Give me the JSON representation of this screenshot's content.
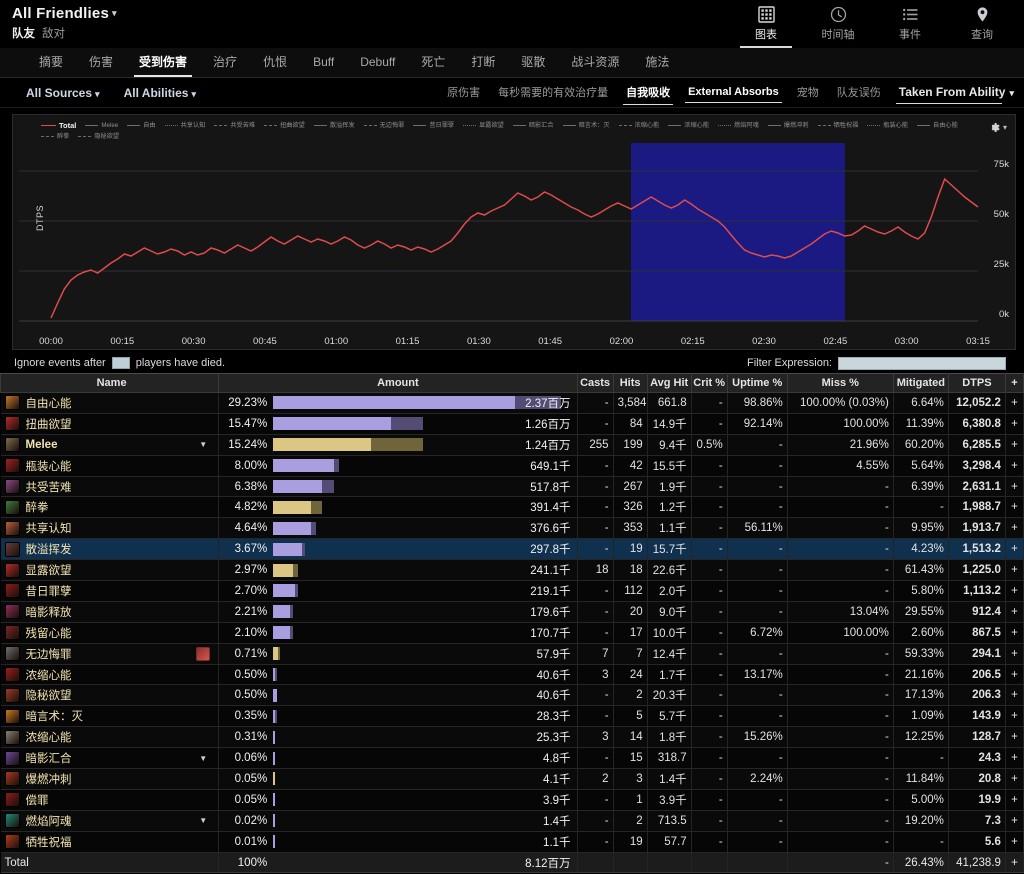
{
  "header": {
    "fight_title": "All Friendlies",
    "fight_caret": "▾",
    "sub_friendly": "队友",
    "sub_enemy": "敌对",
    "nav": [
      {
        "label": "图表",
        "icon": "grid-icon",
        "active": true
      },
      {
        "label": "时间轴",
        "icon": "clock-icon",
        "active": false
      },
      {
        "label": "事件",
        "icon": "list-icon",
        "active": false
      },
      {
        "label": "查询",
        "icon": "pin-icon",
        "active": false
      }
    ]
  },
  "tabs": [
    {
      "label": "摘要",
      "active": false
    },
    {
      "label": "伤害",
      "active": false
    },
    {
      "label": "受到伤害",
      "active": true
    },
    {
      "label": "治疗",
      "active": false
    },
    {
      "label": "仇恨",
      "active": false
    },
    {
      "label": "Buff",
      "active": false
    },
    {
      "label": "Debuff",
      "active": false
    },
    {
      "label": "死亡",
      "active": false
    },
    {
      "label": "打断",
      "active": false
    },
    {
      "label": "驱散",
      "active": false
    },
    {
      "label": "战斗资源",
      "active": false
    },
    {
      "label": "施法",
      "active": false
    }
  ],
  "filters": {
    "sources": "All Sources",
    "abilities": "All Abilities",
    "caret": "▾",
    "modes": [
      {
        "label": "原伤害",
        "active": false
      },
      {
        "label": "每秒需要的有效治疗量",
        "active": false
      },
      {
        "label": "自我吸收",
        "active": true
      },
      {
        "label": "External Absorbs",
        "active": true
      },
      {
        "label": "宠物",
        "active": false
      },
      {
        "label": "队友误伤",
        "active": false
      }
    ],
    "dropdown": "Taken From Ability"
  },
  "chart_data": {
    "type": "line",
    "title": "",
    "xlabel": "",
    "ylabel": "DTPS",
    "ylim": [
      0,
      85000
    ],
    "yticks": [
      "0k",
      "25k",
      "50k",
      "75k"
    ],
    "ytick_values": [
      0,
      25000,
      50000,
      75000
    ],
    "xticks": [
      "00:00",
      "00:15",
      "00:30",
      "00:45",
      "01:00",
      "01:15",
      "01:30",
      "01:45",
      "02:00",
      "02:15",
      "02:30",
      "02:45",
      "03:00",
      "03:15"
    ],
    "grid": true,
    "legend_position": "top",
    "line_color": "#e04b4b",
    "highlight_color": "#1a1a82",
    "highlight_range": [
      "02:02",
      "02:47"
    ],
    "series": [
      {
        "name": "Total",
        "values": [
          1500,
          9000,
          16000,
          20500,
          23000,
          24500,
          25500,
          24000,
          26500,
          29000,
          31000,
          33500,
          32500,
          34500,
          36500,
          35000,
          33500,
          34500,
          36000,
          35000,
          33000,
          34500,
          33000,
          34000,
          36500,
          35500,
          34000,
          36000,
          38000,
          36500,
          35000,
          37000,
          39500,
          42000,
          40000,
          38500,
          40500,
          42500,
          41000,
          39500,
          41000,
          40000,
          38500,
          40000,
          42000,
          40500,
          38000,
          36500,
          38000,
          40000,
          38500,
          36500,
          38000,
          37000,
          35500,
          37000,
          36000,
          34500,
          36000,
          38000,
          40000,
          44000,
          48500,
          52000,
          54000,
          53000,
          55000,
          56500,
          58000,
          61000,
          64000,
          62500,
          60500,
          62000,
          64500,
          63000,
          61000,
          59000,
          57000,
          55500,
          53500,
          52000,
          53500,
          55500,
          57500,
          59000,
          57500,
          56000,
          58000,
          60000,
          62000,
          60000,
          58000,
          56500,
          58000,
          60500,
          58500,
          56000,
          54000,
          52000,
          50000,
          47000,
          43000,
          39000,
          35500,
          34000,
          33000,
          32000,
          33000,
          32500,
          31500,
          32500,
          34500,
          36500,
          38500,
          41000,
          43500,
          45000,
          44000,
          42500,
          43000,
          45000,
          47500,
          46000,
          44500,
          43500,
          45000,
          47000,
          44500,
          42500,
          41000,
          44000,
          52000,
          62000,
          71000,
          68000,
          65000,
          62000,
          59500,
          57000
        ]
      }
    ],
    "legend": [
      {
        "label": "Total",
        "style": "solid",
        "color": "#e04b4b",
        "total": true
      },
      {
        "label": "Melee",
        "style": "solid"
      },
      {
        "label": "自由",
        "style": "solid"
      },
      {
        "label": "共享认知",
        "style": "dotted"
      },
      {
        "label": "共受苦难",
        "style": "dash-dot"
      },
      {
        "label": "扭曲欲望",
        "style": "dashed"
      },
      {
        "label": "散溢挥发",
        "style": "solid"
      },
      {
        "label": "无边悔罪",
        "style": "dash-dot"
      },
      {
        "label": "昔日罪孽",
        "style": "solid"
      },
      {
        "label": "显露欲望",
        "style": "dotted"
      },
      {
        "label": "暗影汇合",
        "style": "solid"
      },
      {
        "label": "暗言术：灭",
        "style": "solid"
      },
      {
        "label": "浓缩心能",
        "style": "dashed"
      },
      {
        "label": "浓缩心能",
        "style": "solid"
      },
      {
        "label": "燃焰阿魂",
        "style": "dotted"
      },
      {
        "label": "爆燃冲刺",
        "style": "solid"
      },
      {
        "label": "牺牲祝福",
        "style": "dashed"
      },
      {
        "label": "瓶装心能",
        "style": "dotted"
      },
      {
        "label": "自由心能",
        "style": "solid"
      },
      {
        "label": "醉拳",
        "style": "dashed"
      },
      {
        "label": "隐秘欲望",
        "style": "dash-dot"
      }
    ]
  },
  "ignore": {
    "prefix": "Ignore events after",
    "suffix": "players have died.",
    "checked": false
  },
  "filter_expression": {
    "label": "Filter Expression:",
    "value": "",
    "placeholder": ""
  },
  "table": {
    "columns": [
      "Name",
      "Amount",
      "Casts",
      "Hits",
      "Avg Hit",
      "Crit %",
      "Uptime %",
      "Miss %",
      "Mitigated",
      "DTPS",
      "+"
    ],
    "rows": [
      {
        "name": "自由心能",
        "icon_color": "#c8772c",
        "pct": "29.23%",
        "pct_val": 29.23,
        "bar_lite": 84,
        "bar_dark": 16,
        "bar_color": "purple",
        "amount": "2.37百万",
        "casts": "-",
        "hits": "3,584",
        "avg_hit": "661.8",
        "crit": "-",
        "uptime": "98.86%",
        "miss": "100.00% (0.03%)",
        "mitigated": "6.64%",
        "dtps": "12,052.2",
        "plus": "+",
        "caret": false,
        "extra_icon": false,
        "selected": false
      },
      {
        "name": "扭曲欲望",
        "icon_color": "#b42a2a",
        "pct": "15.47%",
        "pct_val": 15.47,
        "bar_lite": 41,
        "bar_dark": 11,
        "bar_color": "purple",
        "amount": "1.26百万",
        "casts": "-",
        "hits": "84",
        "avg_hit": "14.9千",
        "crit": "-",
        "uptime": "92.14%",
        "miss": "100.00%",
        "mitigated": "11.39%",
        "dtps": "6,380.8",
        "plus": "+",
        "caret": false,
        "extra_icon": false,
        "selected": false
      },
      {
        "name": "Melee",
        "icon_color": "#7a6a52",
        "pct": "15.24%",
        "pct_val": 15.24,
        "bar_lite": 34,
        "bar_dark": 18,
        "bar_color": "tan",
        "amount": "1.24百万",
        "casts": "255",
        "hits": "199",
        "avg_hit": "9.4千",
        "crit": "0.5%",
        "uptime": "-",
        "miss": "21.96%",
        "mitigated": "60.20%",
        "dtps": "6,285.5",
        "plus": "+",
        "caret": true,
        "extra_icon": false,
        "selected": false,
        "en": true
      },
      {
        "name": "瓶装心能",
        "icon_color": "#a32020",
        "pct": "8.00%",
        "pct_val": 8.0,
        "bar_lite": 21,
        "bar_dark": 2,
        "bar_color": "purple",
        "amount": "649.1千",
        "casts": "-",
        "hits": "42",
        "avg_hit": "15.5千",
        "crit": "-",
        "uptime": "-",
        "miss": "4.55%",
        "mitigated": "5.64%",
        "dtps": "3,298.4",
        "plus": "+",
        "caret": false,
        "extra_icon": false,
        "selected": false
      },
      {
        "name": "共受苦难",
        "icon_color": "#8a4a86",
        "pct": "6.38%",
        "pct_val": 6.38,
        "bar_lite": 17,
        "bar_dark": 4,
        "bar_color": "purple",
        "amount": "517.8千",
        "casts": "-",
        "hits": "267",
        "avg_hit": "1.9千",
        "crit": "-",
        "uptime": "-",
        "miss": "-",
        "mitigated": "6.39%",
        "dtps": "2,631.1",
        "plus": "+",
        "caret": false,
        "extra_icon": false,
        "selected": false
      },
      {
        "name": "醉拳",
        "icon_color": "#3f7a3f",
        "pct": "4.82%",
        "pct_val": 4.82,
        "bar_lite": 13,
        "bar_dark": 4,
        "bar_color": "tan",
        "amount": "391.4千",
        "casts": "-",
        "hits": "326",
        "avg_hit": "1.2千",
        "crit": "-",
        "uptime": "-",
        "miss": "-",
        "mitigated": "-",
        "dtps": "1,988.7",
        "plus": "+",
        "caret": false,
        "extra_icon": false,
        "selected": false
      },
      {
        "name": "共享认知",
        "icon_color": "#b8603a",
        "pct": "4.64%",
        "pct_val": 4.64,
        "bar_lite": 13,
        "bar_dark": 2,
        "bar_color": "purple",
        "amount": "376.6千",
        "casts": "-",
        "hits": "353",
        "avg_hit": "1.1千",
        "crit": "-",
        "uptime": "56.11%",
        "miss": "-",
        "mitigated": "9.95%",
        "dtps": "1,913.7",
        "plus": "+",
        "caret": false,
        "extra_icon": false,
        "selected": false
      },
      {
        "name": "散溢挥发",
        "icon_color": "#6a3c3c",
        "pct": "3.67%",
        "pct_val": 3.67,
        "bar_lite": 10,
        "bar_dark": 1,
        "bar_color": "purple",
        "amount": "297.8千",
        "casts": "-",
        "hits": "19",
        "avg_hit": "15.7千",
        "crit": "-",
        "uptime": "-",
        "miss": "-",
        "mitigated": "4.23%",
        "dtps": "1,513.2",
        "plus": "+",
        "caret": false,
        "extra_icon": false,
        "selected": true
      },
      {
        "name": "显露欲望",
        "icon_color": "#b42a2a",
        "pct": "2.97%",
        "pct_val": 2.97,
        "bar_lite": 7,
        "bar_dark": 1.5,
        "bar_color": "tan",
        "amount": "241.1千",
        "casts": "18",
        "hits": "18",
        "avg_hit": "22.6千",
        "crit": "-",
        "uptime": "-",
        "miss": "-",
        "mitigated": "61.43%",
        "dtps": "1,225.0",
        "plus": "+",
        "caret": false,
        "extra_icon": false,
        "selected": false
      },
      {
        "name": "昔日罪孽",
        "icon_color": "#8c1c1c",
        "pct": "2.70%",
        "pct_val": 2.7,
        "bar_lite": 7.5,
        "bar_dark": 1,
        "bar_color": "purple",
        "amount": "219.1千",
        "casts": "-",
        "hits": "112",
        "avg_hit": "2.0千",
        "crit": "-",
        "uptime": "-",
        "miss": "-",
        "mitigated": "5.80%",
        "dtps": "1,113.2",
        "plus": "+",
        "caret": false,
        "extra_icon": false,
        "selected": false
      },
      {
        "name": "暗影释放",
        "icon_color": "#8e2d5e",
        "pct": "2.21%",
        "pct_val": 2.21,
        "bar_lite": 6,
        "bar_dark": 1,
        "bar_color": "purple",
        "amount": "179.6千",
        "casts": "-",
        "hits": "20",
        "avg_hit": "9.0千",
        "crit": "-",
        "uptime": "-",
        "miss": "13.04%",
        "mitigated": "29.55%",
        "dtps": "912.4",
        "plus": "+",
        "caret": false,
        "extra_icon": false,
        "selected": false
      },
      {
        "name": "残留心能",
        "icon_color": "#7a2626",
        "pct": "2.10%",
        "pct_val": 2.1,
        "bar_lite": 6,
        "bar_dark": 1,
        "bar_color": "purple",
        "amount": "170.7千",
        "casts": "-",
        "hits": "17",
        "avg_hit": "10.0千",
        "crit": "-",
        "uptime": "6.72%",
        "miss": "100.00%",
        "mitigated": "2.60%",
        "dtps": "867.5",
        "plus": "+",
        "caret": false,
        "extra_icon": false,
        "selected": false
      },
      {
        "name": "无边悔罪",
        "icon_color": "#6e6e6e",
        "pct": "0.71%",
        "pct_val": 0.71,
        "bar_lite": 1.6,
        "bar_dark": 0.9,
        "bar_color": "tan",
        "amount": "57.9千",
        "casts": "7",
        "hits": "7",
        "avg_hit": "12.4千",
        "crit": "-",
        "uptime": "-",
        "miss": "-",
        "mitigated": "59.33%",
        "dtps": "294.1",
        "plus": "+",
        "caret": false,
        "extra_icon": true,
        "selected": false
      },
      {
        "name": "浓缩心能",
        "icon_color": "#9b1f1f",
        "pct": "0.50%",
        "pct_val": 0.5,
        "bar_lite": 0.7,
        "bar_dark": 0.7,
        "bar_color": "purple",
        "amount": "40.6千",
        "casts": "3",
        "hits": "24",
        "avg_hit": "1.7千",
        "crit": "-",
        "uptime": "13.17%",
        "miss": "-",
        "mitigated": "21.16%",
        "dtps": "206.5",
        "plus": "+",
        "caret": false,
        "extra_icon": false,
        "selected": false
      },
      {
        "name": "隐秘欲望",
        "icon_color": "#9b3a2a",
        "pct": "0.50%",
        "pct_val": 0.5,
        "bar_lite": 1.4,
        "bar_dark": 0,
        "bar_color": "purple",
        "amount": "40.6千",
        "casts": "-",
        "hits": "2",
        "avg_hit": "20.3千",
        "crit": "-",
        "uptime": "-",
        "miss": "-",
        "mitigated": "17.13%",
        "dtps": "206.3",
        "plus": "+",
        "caret": false,
        "extra_icon": false,
        "selected": false
      },
      {
        "name": "暗言术：灭",
        "icon_color": "#c87a1e",
        "pct": "0.35%",
        "pct_val": 0.35,
        "bar_lite": 0.6,
        "bar_dark": 0.6,
        "bar_color": "purple",
        "amount": "28.3千",
        "casts": "-",
        "hits": "5",
        "avg_hit": "5.7千",
        "crit": "-",
        "uptime": "-",
        "miss": "-",
        "mitigated": "1.09%",
        "dtps": "143.9",
        "plus": "+",
        "caret": false,
        "extra_icon": false,
        "selected": false
      },
      {
        "name": "浓缩心能",
        "icon_color": "#8a8070",
        "pct": "0.31%",
        "pct_val": 0.31,
        "bar_lite": 0.7,
        "bar_dark": 0,
        "bar_color": "purple",
        "amount": "25.3千",
        "casts": "3",
        "hits": "14",
        "avg_hit": "1.8千",
        "crit": "-",
        "uptime": "15.26%",
        "miss": "-",
        "mitigated": "12.25%",
        "dtps": "128.7",
        "plus": "+",
        "caret": false,
        "extra_icon": false,
        "selected": false
      },
      {
        "name": "暗影汇合",
        "icon_color": "#6a4a9c",
        "pct": "0.06%",
        "pct_val": 0.06,
        "bar_lite": 0.6,
        "bar_dark": 0,
        "bar_color": "purple",
        "amount": "4.8千",
        "casts": "-",
        "hits": "15",
        "avg_hit": "318.7",
        "crit": "-",
        "uptime": "-",
        "miss": "-",
        "mitigated": "-",
        "dtps": "24.3",
        "plus": "+",
        "caret": true,
        "extra_icon": false,
        "selected": false
      },
      {
        "name": "爆燃冲刺",
        "icon_color": "#a83820",
        "pct": "0.05%",
        "pct_val": 0.05,
        "bar_lite": 0.6,
        "bar_dark": 0,
        "bar_color": "tan",
        "amount": "4.1千",
        "casts": "2",
        "hits": "3",
        "avg_hit": "1.4千",
        "crit": "-",
        "uptime": "2.24%",
        "miss": "-",
        "mitigated": "11.84%",
        "dtps": "20.8",
        "plus": "+",
        "caret": false,
        "extra_icon": false,
        "selected": false
      },
      {
        "name": "偿罪",
        "icon_color": "#8c1c1c",
        "pct": "0.05%",
        "pct_val": 0.05,
        "bar_lite": 0.6,
        "bar_dark": 0,
        "bar_color": "purple",
        "amount": "3.9千",
        "casts": "-",
        "hits": "1",
        "avg_hit": "3.9千",
        "crit": "-",
        "uptime": "-",
        "miss": "-",
        "mitigated": "5.00%",
        "dtps": "19.9",
        "plus": "+",
        "caret": false,
        "extra_icon": false,
        "selected": false
      },
      {
        "name": "燃焰阿魂",
        "icon_color": "#1f8a7a",
        "pct": "0.02%",
        "pct_val": 0.02,
        "bar_lite": 0.6,
        "bar_dark": 0,
        "bar_color": "purple",
        "amount": "1.4千",
        "casts": "-",
        "hits": "2",
        "avg_hit": "713.5",
        "crit": "-",
        "uptime": "-",
        "miss": "-",
        "mitigated": "19.20%",
        "dtps": "7.3",
        "plus": "+",
        "caret": true,
        "extra_icon": false,
        "selected": false
      },
      {
        "name": "牺牲祝福",
        "icon_color": "#b03a1e",
        "pct": "0.01%",
        "pct_val": 0.01,
        "bar_lite": 0.6,
        "bar_dark": 0,
        "bar_color": "purple",
        "amount": "1.1千",
        "casts": "-",
        "hits": "19",
        "avg_hit": "57.7",
        "crit": "-",
        "uptime": "-",
        "miss": "-",
        "mitigated": "-",
        "dtps": "5.6",
        "plus": "+",
        "caret": false,
        "extra_icon": false,
        "selected": false
      }
    ],
    "total_row": {
      "name": "Total",
      "pct": "100%",
      "amount": "8.12百万",
      "casts": "",
      "hits": "",
      "avg_hit": "",
      "crit": "",
      "uptime": "",
      "miss": "-",
      "mitigated": "26.43%",
      "dtps": "41,238.9",
      "plus": "+"
    }
  }
}
